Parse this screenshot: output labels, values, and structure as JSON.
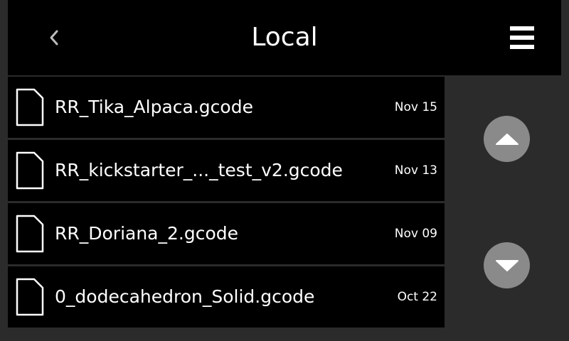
{
  "header": {
    "title": "Local",
    "back_icon": "chevron-left-icon",
    "menu_icon": "hamburger-menu-icon"
  },
  "files": [
    {
      "name": "RR_Tika_Alpaca.gcode",
      "date": "Nov 15",
      "icon": "file-icon"
    },
    {
      "name": "RR_kickstarter_..._test_v2.gcode",
      "date": "Nov 13",
      "icon": "file-icon"
    },
    {
      "name": "RR_Doriana_2.gcode",
      "date": "Nov 09",
      "icon": "file-icon"
    },
    {
      "name": "0_dodecahedron_Solid.gcode",
      "date": "Oct 22",
      "icon": "file-icon"
    }
  ],
  "scroll": {
    "up_icon": "arrow-up-icon",
    "down_icon": "arrow-down-icon"
  },
  "colors": {
    "background": "#2b2b2b",
    "panel": "#000000",
    "text": "#ffffff",
    "scroll_button": "#8a8a8a"
  }
}
